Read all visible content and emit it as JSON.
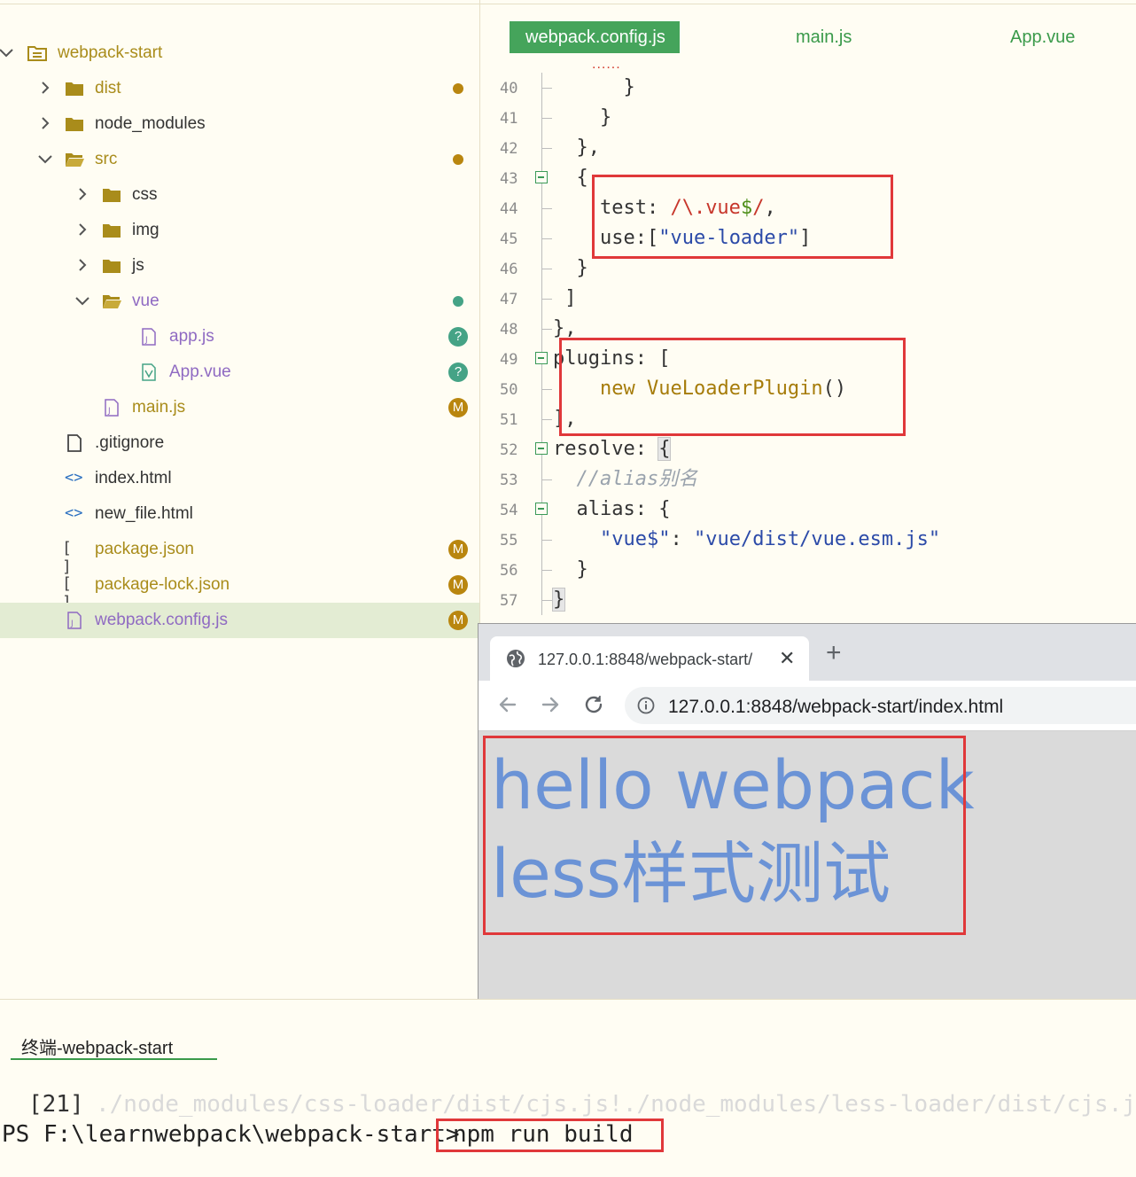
{
  "sidebar": {
    "items": [
      {
        "label": "webpack-start",
        "badge": ""
      },
      {
        "label": "dist",
        "badge": "dot"
      },
      {
        "label": "node_modules",
        "badge": ""
      },
      {
        "label": "src",
        "badge": "dot"
      },
      {
        "label": "css",
        "badge": ""
      },
      {
        "label": "img",
        "badge": ""
      },
      {
        "label": "js",
        "badge": ""
      },
      {
        "label": "vue",
        "badge": "dot"
      },
      {
        "label": "app.js",
        "badge": "?"
      },
      {
        "label": "App.vue",
        "badge": "?"
      },
      {
        "label": "main.js",
        "badge": "M"
      },
      {
        "label": ".gitignore",
        "badge": ""
      },
      {
        "label": "index.html",
        "badge": ""
      },
      {
        "label": "new_file.html",
        "badge": ""
      },
      {
        "label": "package.json",
        "badge": "M"
      },
      {
        "label": "package-lock.json",
        "badge": "M"
      },
      {
        "label": "webpack.config.js",
        "badge": "M"
      }
    ],
    "selected": "webpack.config.js",
    "html_icon": "<>",
    "json_icon": "[ ]"
  },
  "editor": {
    "tabs": [
      "webpack.config.js",
      "main.js",
      "App.vue"
    ],
    "active_tab": "webpack.config.js",
    "ellipsis": "......",
    "lines": [
      {
        "n": "40",
        "parts": [
          [
            "",
            "      }"
          ]
        ]
      },
      {
        "n": "41",
        "parts": [
          [
            "",
            "    }"
          ]
        ]
      },
      {
        "n": "42",
        "parts": [
          [
            "",
            "  },"
          ]
        ]
      },
      {
        "n": "43",
        "parts": [
          [
            "",
            "  {"
          ]
        ]
      },
      {
        "n": "44",
        "parts": [
          [
            "",
            "    test: "
          ],
          [
            "red",
            "/\\.vue"
          ],
          [
            "green",
            "$"
          ],
          [
            "red",
            "/"
          ],
          [
            "",
            ","
          ]
        ]
      },
      {
        "n": "45",
        "parts": [
          [
            "",
            "    use:["
          ],
          [
            "str",
            "\"vue-loader\""
          ],
          [
            "",
            "]"
          ]
        ]
      },
      {
        "n": "46",
        "parts": [
          [
            "",
            "  }"
          ]
        ]
      },
      {
        "n": "47",
        "parts": [
          [
            "",
            " ]"
          ]
        ]
      },
      {
        "n": "48",
        "parts": [
          [
            "",
            "},"
          ]
        ]
      },
      {
        "n": "49",
        "parts": [
          [
            "",
            "plugins: ["
          ]
        ]
      },
      {
        "n": "50",
        "parts": [
          [
            "",
            "    "
          ],
          [
            "olive",
            "new"
          ],
          [
            "",
            " "
          ],
          [
            "olive",
            "VueLoaderPlugin"
          ],
          [
            "",
            "()"
          ]
        ]
      },
      {
        "n": "51",
        "parts": [
          [
            "",
            "],"
          ]
        ]
      },
      {
        "n": "52",
        "parts": [
          [
            "",
            "resolve: "
          ],
          [
            "hl",
            "{"
          ]
        ]
      },
      {
        "n": "53",
        "parts": [
          [
            "comment",
            "  //alias别名"
          ]
        ]
      },
      {
        "n": "54",
        "parts": [
          [
            "",
            "  alias: {"
          ]
        ]
      },
      {
        "n": "55",
        "parts": [
          [
            "",
            "    "
          ],
          [
            "str",
            "\"vue$\""
          ],
          [
            "",
            ": "
          ],
          [
            "str",
            "\"vue/dist/vue.esm.js\""
          ]
        ]
      },
      {
        "n": "56",
        "parts": [
          [
            "",
            "  }"
          ]
        ]
      },
      {
        "n": "57",
        "parts": [
          [
            "hl",
            "}"
          ]
        ]
      }
    ]
  },
  "browser": {
    "tab_title": "127.0.0.1:8848/webpack-start/",
    "url": "127.0.0.1:8848/webpack-start/index.html",
    "page_lines": [
      "hello webpack",
      "less样式测试"
    ]
  },
  "terminal": {
    "tab_label": "终端-webpack-start",
    "log_number": "[21]",
    "log_path": "./node_modules/css-loader/dist/cjs.js!./node_modules/less-loader/dist/cjs.js!./",
    "prompt": "PS F:\\learnwebpack\\webpack-start>",
    "command": "npm run build"
  },
  "colors": {
    "accent_green": "#45a45b",
    "highlight_red": "#e0383a",
    "page_text_blue": "#6b93d6",
    "badge_modified": "#b9860f",
    "badge_untracked": "#45a386"
  }
}
